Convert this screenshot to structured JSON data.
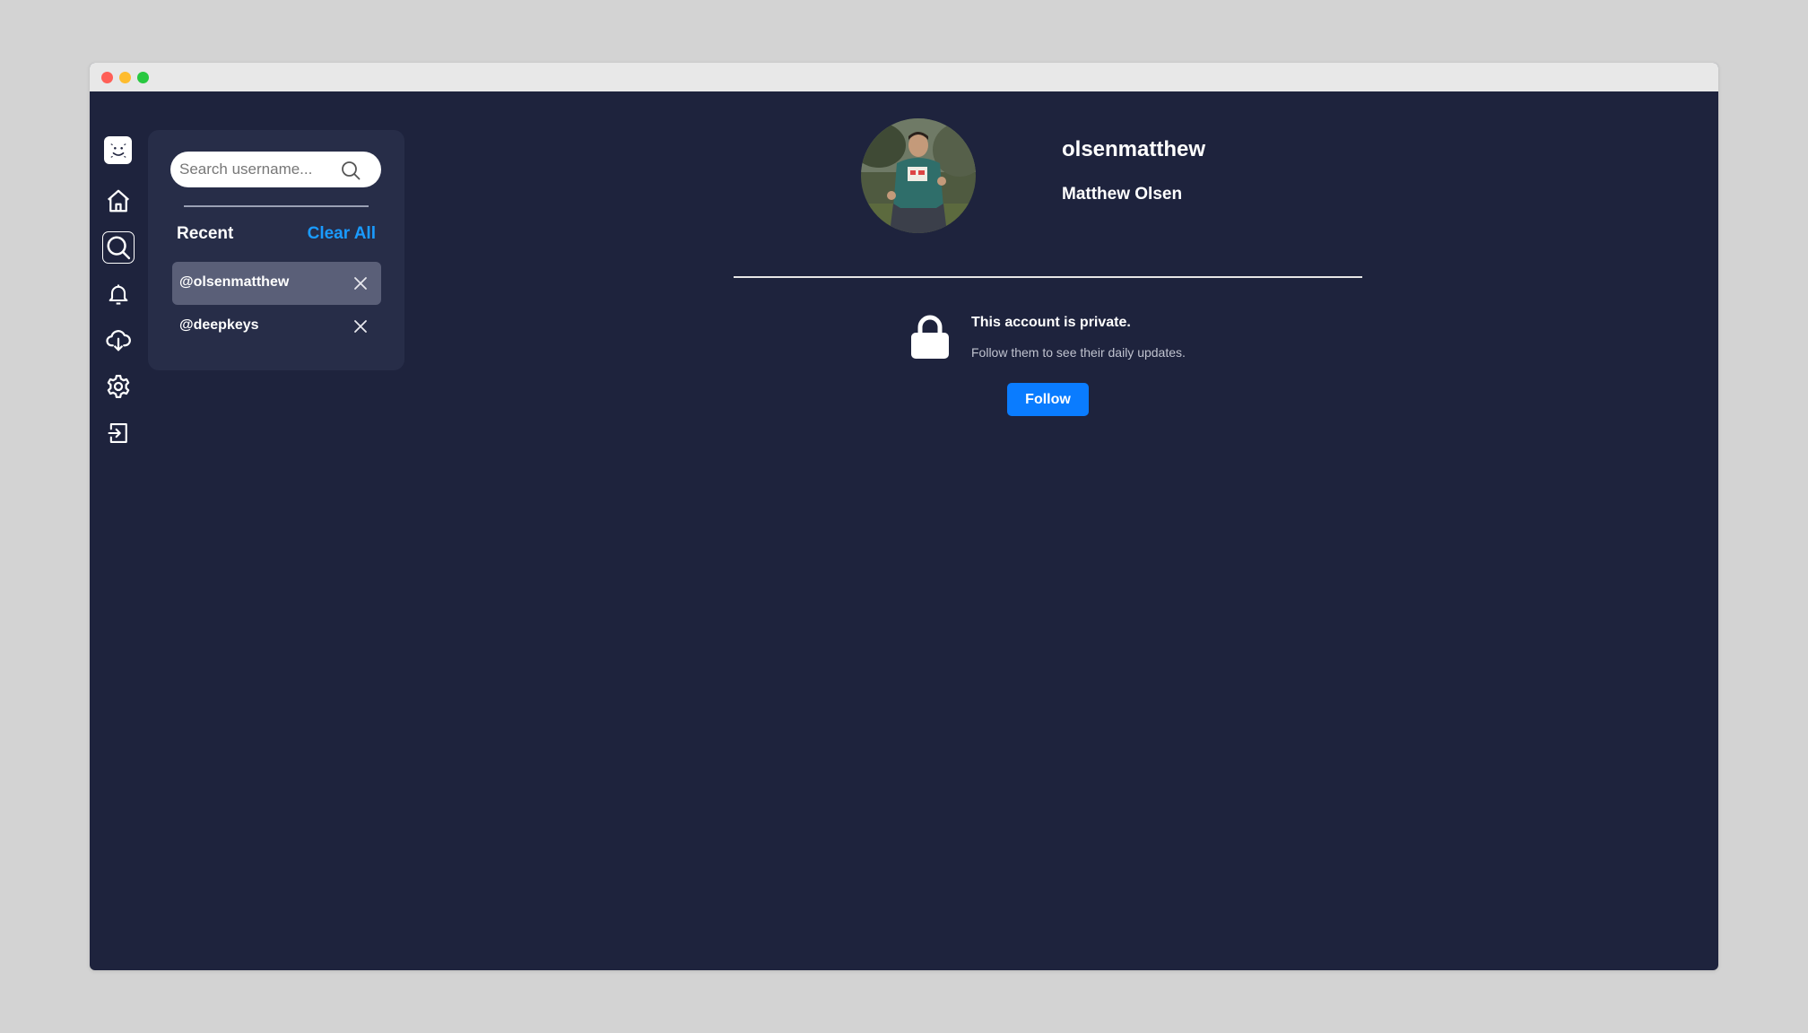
{
  "window": {
    "controls": [
      "close",
      "minimize",
      "maximize"
    ]
  },
  "rail": {
    "items": [
      {
        "name": "app-logo",
        "icon": "smiley-logo-icon"
      },
      {
        "name": "home",
        "icon": "home-icon"
      },
      {
        "name": "search",
        "icon": "search-icon",
        "active": true
      },
      {
        "name": "notifications",
        "icon": "bell-icon"
      },
      {
        "name": "download",
        "icon": "cloud-download-icon"
      },
      {
        "name": "settings",
        "icon": "gear-icon"
      },
      {
        "name": "logout",
        "icon": "logout-icon"
      }
    ]
  },
  "search": {
    "placeholder": "Search username...",
    "value": "",
    "recent_label": "Recent",
    "clear_all_label": "Clear All",
    "recent": [
      {
        "handle": "@olsenmatthew",
        "highlighted": true
      },
      {
        "handle": "@deepkeys",
        "highlighted": false
      }
    ]
  },
  "profile": {
    "username": "olsenmatthew",
    "full_name": "Matthew Olsen",
    "private_title": "This account is private.",
    "private_subtitle": "Follow them to see their daily updates.",
    "follow_label": "Follow"
  },
  "colors": {
    "background": "#1e233d",
    "panel": "#272d48",
    "accent_link": "#1a9bff",
    "follow_button": "#0a7cff",
    "recent_highlight": "#5a5f78"
  }
}
